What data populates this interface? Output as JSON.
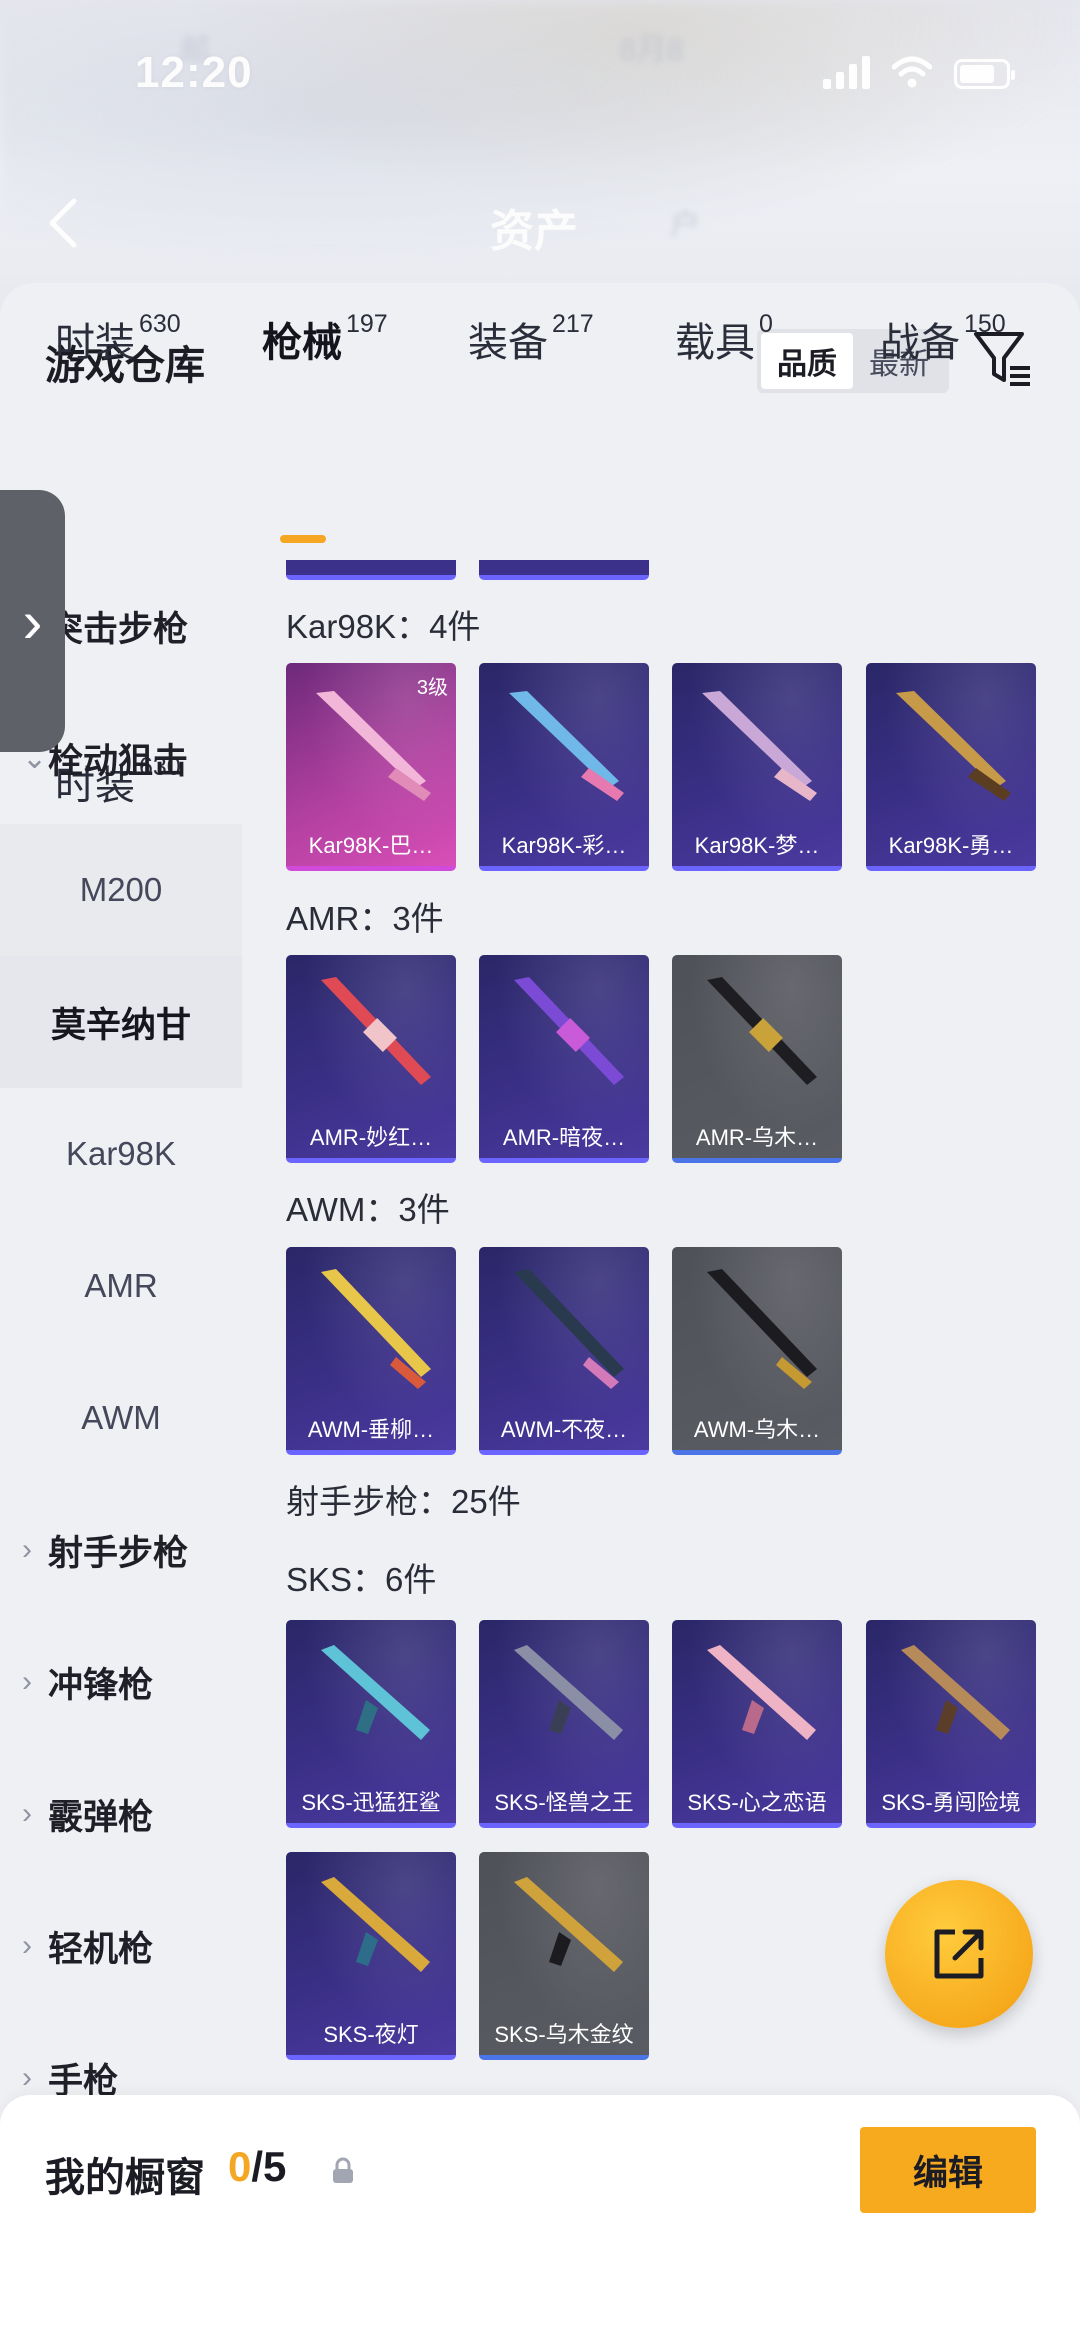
{
  "status_bar": {
    "time": "12:20"
  },
  "header": {
    "title": "资产",
    "blurred_left": "邮",
    "blurred_mid": "8月8",
    "blurred_right": "户"
  },
  "sheet": {
    "title": "游戏仓库",
    "sort_options": [
      "品质",
      "最新"
    ],
    "active_sort": "品质"
  },
  "tabs": [
    {
      "label": "时装",
      "count": "630"
    },
    {
      "label": "枪械",
      "count": "197",
      "active": true
    },
    {
      "label": "装备",
      "count": "217"
    },
    {
      "label": "载具",
      "count": "0"
    },
    {
      "label": "战备",
      "count": "150"
    }
  ],
  "sidebar": {
    "items": [
      {
        "label": "突击步枪",
        "kind": "group"
      },
      {
        "label": "栓动狙击",
        "kind": "group-open"
      },
      {
        "label": "M200",
        "kind": "sub"
      },
      {
        "label": "莫辛纳甘",
        "kind": "selected"
      },
      {
        "label": "Kar98K",
        "kind": "sub"
      },
      {
        "label": "AMR",
        "kind": "sub"
      },
      {
        "label": "AWM",
        "kind": "sub"
      },
      {
        "label": "射手步枪",
        "kind": "group"
      },
      {
        "label": "冲锋枪",
        "kind": "group"
      },
      {
        "label": "霰弹枪",
        "kind": "group"
      },
      {
        "label": "轻机枪",
        "kind": "group"
      },
      {
        "label": "手枪",
        "kind": "group"
      }
    ]
  },
  "sections": [
    {
      "title": "Kar98K：4件"
    },
    {
      "title": "AMR：3件"
    },
    {
      "title": "AWM：3件"
    },
    {
      "title": "射手步枪：25件"
    },
    {
      "title": "SKS：6件"
    }
  ],
  "cards": {
    "kar98k": [
      {
        "name": "Kar98K-巴…",
        "style": "pink",
        "level": "3级"
      },
      {
        "name": "Kar98K-彩…",
        "style": "purple"
      },
      {
        "name": "Kar98K-梦…",
        "style": "purple"
      },
      {
        "name": "Kar98K-勇…",
        "style": "purple"
      }
    ],
    "amr": [
      {
        "name": "AMR-妙红…",
        "style": "purple"
      },
      {
        "name": "AMR-暗夜…",
        "style": "purple"
      },
      {
        "name": "AMR-乌木…",
        "style": "grey"
      }
    ],
    "awm": [
      {
        "name": "AWM-垂柳…",
        "style": "purple"
      },
      {
        "name": "AWM-不夜…",
        "style": "purple"
      },
      {
        "name": "AWM-乌木…",
        "style": "grey"
      }
    ],
    "sks": [
      {
        "name": "SKS-迅猛狂鲨",
        "style": "purple"
      },
      {
        "name": "SKS-怪兽之王",
        "style": "purple"
      },
      {
        "name": "SKS-心之恋语",
        "style": "purple"
      },
      {
        "name": "SKS-勇闯险境",
        "style": "purple"
      },
      {
        "name": "SKS-夜灯",
        "style": "purple"
      },
      {
        "name": "SKS-乌木金纹",
        "style": "grey"
      }
    ]
  },
  "showcase": {
    "title": "我的橱窗",
    "current": "0",
    "total": "/5",
    "edit_label": "编辑"
  },
  "colors": {
    "accent": "#f5a623",
    "card_purple": "#3a2f86",
    "card_pink": "#b03f9f",
    "card_grey": "#55575e"
  }
}
